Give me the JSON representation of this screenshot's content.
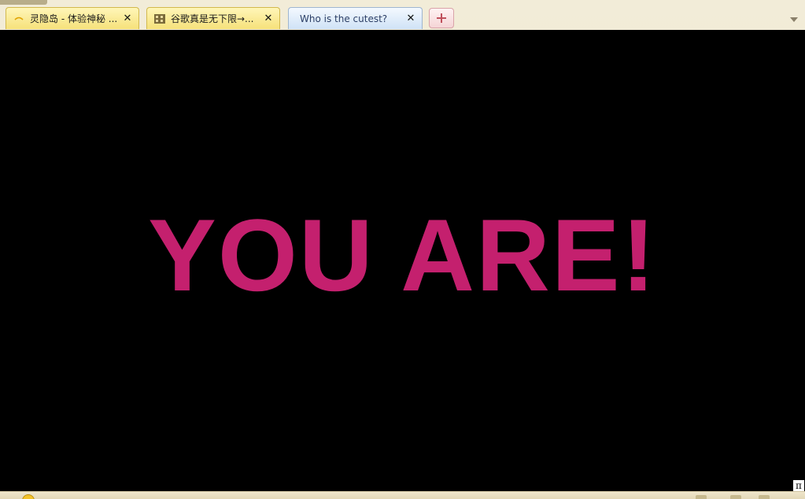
{
  "browser": {
    "tabs": [
      {
        "title": "灵隐岛 - 体验神秘 ...",
        "close": "✕",
        "icon": "moon-icon",
        "active": false
      },
      {
        "title": "谷歌真是无下限→...",
        "close": "✕",
        "icon": "film-icon",
        "active": false
      },
      {
        "title": "Who is the cutest?",
        "close": "✕",
        "icon": "",
        "active": true
      }
    ],
    "new_tab_label": "+",
    "tab_menu_icon": "chevron-down-icon"
  },
  "page": {
    "headline": "YOU ARE!",
    "headline_color": "#c4206e",
    "background_color": "#000000"
  },
  "badge": {
    "label": "π"
  }
}
